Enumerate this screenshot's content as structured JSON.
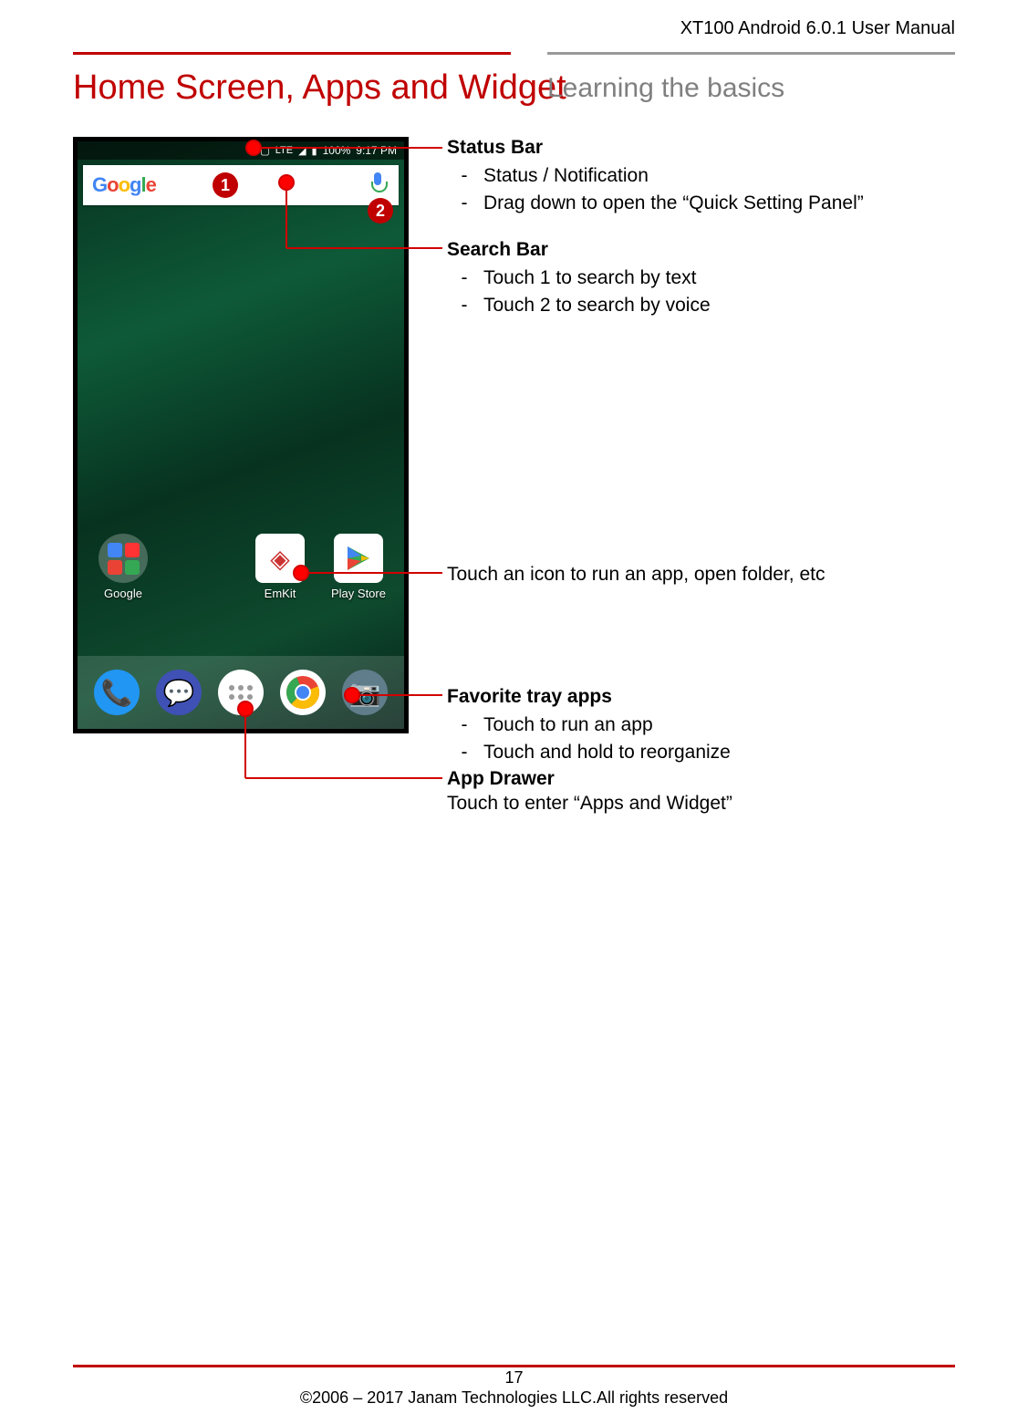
{
  "header": {
    "doc_title": "XT100 Android 6.0.1 User Manual"
  },
  "title_left": "Home Screen, Apps and Widget",
  "title_right": "Learning the basics",
  "status": {
    "battery": "100%",
    "time": "9:17 PM"
  },
  "badges": {
    "one": "1",
    "two": "2"
  },
  "apps_mid": {
    "google": "Google",
    "emkit": "EmKit",
    "play": "Play Store"
  },
  "callouts": {
    "status_bar": {
      "title": "Status Bar",
      "items": [
        "Status / Notification",
        "Drag down to open the “Quick Setting Panel”"
      ]
    },
    "search_bar": {
      "title": "Search Bar",
      "items": [
        "Touch 1 to search by text",
        "Touch 2 to search by voice"
      ]
    },
    "app_icon": {
      "line": "Touch an icon to run an app, open folder, etc"
    },
    "fav_tray": {
      "title": "Favorite tray apps",
      "items": [
        "Touch to run an app",
        "Touch and hold to reorganize"
      ]
    },
    "app_drawer": {
      "title": "App Drawer",
      "line": "Touch to enter “Apps and Widget”"
    }
  },
  "footer": {
    "page": "17",
    "copyright": "©2006 – 2017 Janam Technologies LLC.All rights reserved"
  },
  "colors": {
    "accent_red": "#c00000"
  }
}
